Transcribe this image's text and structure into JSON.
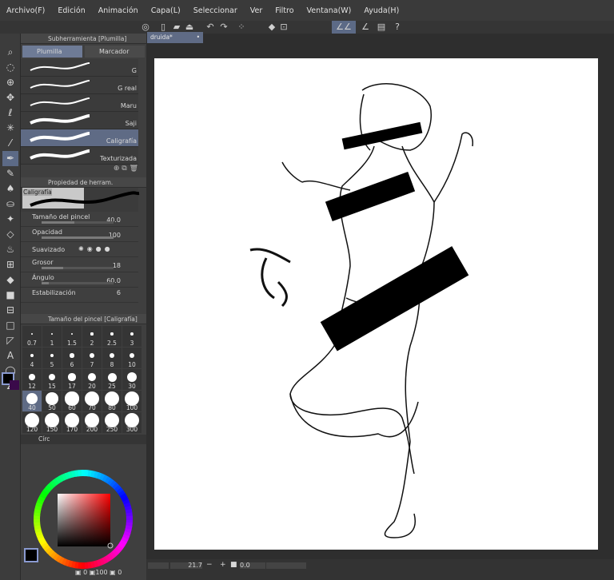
{
  "menu": [
    "Archivo(F)",
    "Edición",
    "Animación",
    "Capa(L)",
    "Seleccionar",
    "Ver",
    "Filtro",
    "Ventana(W)",
    "Ayuda(H)"
  ],
  "document_tab": {
    "title": "druida*"
  },
  "subtool_panel": {
    "title": "Subherramienta [Plumilla]",
    "tabs": [
      "Plumilla",
      "Marcador"
    ],
    "brushes": [
      "G",
      "G real",
      "Maru",
      "Saji",
      "Caligrafía",
      "Texturizada"
    ],
    "selected": "Caligrafía"
  },
  "tool_property": {
    "title": "Propiedad de herram. [Caligrafía]",
    "preview_label": "Caligrafía",
    "props": [
      {
        "label": "Tamaño del pincel",
        "value": "40.0",
        "fill": 0.45
      },
      {
        "label": "Opacidad",
        "value": "100",
        "fill": 1.0
      },
      {
        "label": "Grosor",
        "value": "18",
        "fill": 0.3
      },
      {
        "label": "Ángulo",
        "value": "60.0",
        "fill": 0.1
      }
    ],
    "smoothing_label": "Suavizado",
    "stabilization_label": "Estabilización",
    "stabilization_value": "6"
  },
  "brush_size_panel": {
    "title": "Tamaño del pincel [Caligrafía]",
    "sizes": [
      "0.7",
      "1",
      "1.5",
      "2",
      "2.5",
      "3",
      "4",
      "5",
      "6",
      "7",
      "8",
      "10",
      "12",
      "15",
      "17",
      "20",
      "25",
      "30",
      "40",
      "50",
      "60",
      "70",
      "80",
      "100",
      "120",
      "150",
      "170",
      "200",
      "250",
      "300"
    ],
    "selected": "40",
    "circle_tab": "Círc"
  },
  "color_panel": {
    "main_color": "#000000",
    "sub_color": "#3a0a4a",
    "readout": [
      "0",
      "100",
      "0"
    ]
  },
  "status": {
    "zoom": "21.7",
    "rotation": "0.0"
  }
}
